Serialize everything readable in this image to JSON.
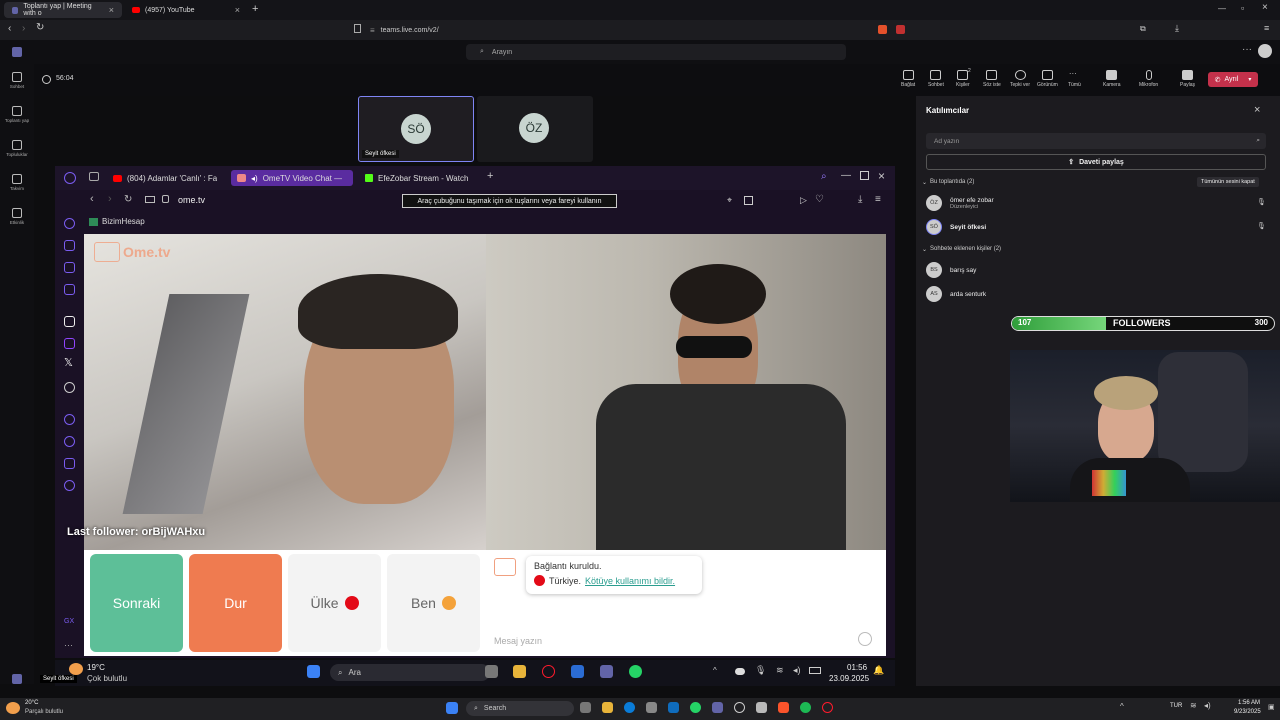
{
  "browser": {
    "tabs": [
      {
        "label": "Toplantı yap | Meeting with o"
      },
      {
        "label": "(4957) YouTube"
      }
    ],
    "url": "teams.live.com/v2/"
  },
  "teams": {
    "search_placeholder": "Arayın",
    "rail": [
      {
        "label": "Sohbet",
        "icon": "chat-icon"
      },
      {
        "label": "Toplantı yap",
        "icon": "video-icon"
      },
      {
        "label": "Topluluklar",
        "icon": "community-icon"
      },
      {
        "label": "Takvim",
        "icon": "calendar-icon"
      },
      {
        "label": "Etkinlik",
        "icon": "bell-icon"
      }
    ],
    "timer": "56:04",
    "toolbar": [
      "Bağlat",
      "Sohbet",
      "Kişiler",
      "Söz iste",
      "Tepki ver",
      "Görünüm",
      "Tümü",
      "Kamera",
      "Mikrofon",
      "Paylaş"
    ],
    "participant_count": "2",
    "leave_label": "Ayrıl",
    "tiles": [
      {
        "initials": "SÖ",
        "name": "Seyit öfkesi"
      },
      {
        "initials": "ÖZ",
        "name": ""
      }
    ],
    "self_label": "Seyit öfkesi"
  },
  "inner_browser": {
    "tabs": [
      {
        "label": "(804) Adamlar 'Canlı' : Fa"
      },
      {
        "label": "OmeTV Video Chat —"
      },
      {
        "label": "EfeZobar Stream - Watch"
      }
    ],
    "url": "ome.tv",
    "tooltip": "Araç çubuğunu taşımak için ok tuşlarını veya fareyi kullanın",
    "bookmark": "BizimHesap"
  },
  "ometv": {
    "logo": "Ome.tv",
    "buttons": [
      {
        "label": "Sonraki",
        "color": "#5dbf98"
      },
      {
        "label": "Dur",
        "color": "#ef7b50"
      },
      {
        "label": "Ülke",
        "color": "#f3f3f3"
      },
      {
        "label": "Ben",
        "color": "#f3f3f3"
      }
    ],
    "connection_status": "Bağlantı kuruldu.",
    "country": "Türkiye.",
    "report_link": "Kötüye kullanımı bildir.",
    "message_placeholder": "Mesaj yazın",
    "last_follower": "Last follower: orBijWAHxu"
  },
  "panel": {
    "title": "Katılımcılar",
    "search_placeholder": "Ad yazın",
    "share_invite": "Daveti paylaş",
    "in_meeting_header": "Bu toplantıda (2)",
    "mute_all": "Tümünün sesini kapat",
    "in_meeting": [
      {
        "initials": "ÖZ",
        "name": "ömer efe zobar",
        "role": "Düzenleyici"
      },
      {
        "initials": "SÖ",
        "name": "Seyit öfkesi",
        "role": ""
      }
    ],
    "added_header": "Sohbete eklenen kişiler (2)",
    "added": [
      {
        "initials": "BS",
        "name": "barış say"
      },
      {
        "initials": "AS",
        "name": "arda senturk"
      }
    ]
  },
  "overlay": {
    "followers_current": "107",
    "followers_label": "FOLLOWERS",
    "followers_goal": "300",
    "progress_fraction": 0.357
  },
  "inner_taskbar": {
    "temp": "19°C",
    "weather": "Çok bulutlu",
    "search": "Ara",
    "time": "01:56",
    "date": "23.09.2025"
  },
  "outer_taskbar": {
    "temp": "20°C",
    "weather": "Parçalı bulutlu",
    "search": "Search",
    "lang": "TUR",
    "time": "1:56 AM",
    "date": "9/23/2025"
  }
}
